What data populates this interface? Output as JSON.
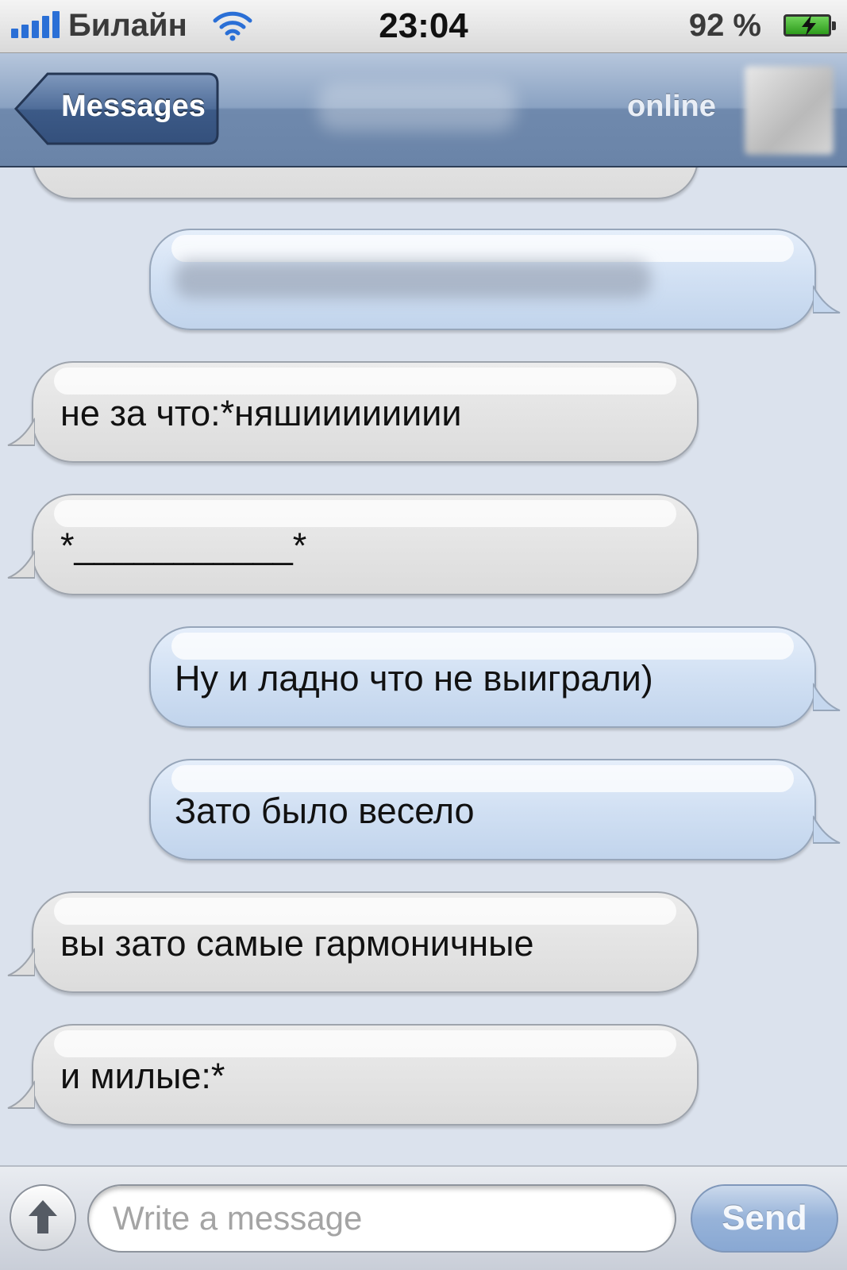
{
  "status_bar": {
    "carrier": "Билайн",
    "time": "23:04",
    "battery_percent": "92 %",
    "battery_level": 0.92,
    "signal_bars": 5,
    "icons": [
      "signal-icon",
      "wifi-icon",
      "battery-charging-icon"
    ]
  },
  "nav": {
    "back_label": "Messages",
    "status_label": "online",
    "icons": [
      "contact-photo"
    ]
  },
  "messages": [
    {
      "direction": "in",
      "text": ""
    },
    {
      "direction": "out",
      "text": ""
    },
    {
      "direction": "in",
      "text": "не за что:*няшииииииии"
    },
    {
      "direction": "in",
      "text": "*___________*"
    },
    {
      "direction": "out",
      "text": "Ну и ладно что не выиграли)"
    },
    {
      "direction": "out",
      "text": "Зато было весело"
    },
    {
      "direction": "in",
      "text": "вы зато самые гармоничные"
    },
    {
      "direction": "in",
      "text": "и милые:*"
    }
  ],
  "composer": {
    "placeholder": "Write a message",
    "send_label": "Send",
    "icons": [
      "camera-upload-icon"
    ]
  },
  "colors": {
    "background": "#dbe2ed",
    "nav_bar": "#6f89ad",
    "incoming_bubble": "#e4e4e4",
    "outgoing_bubble": "#d1e0f3",
    "signal": "#2a6fd6",
    "battery": "#2d9b1c"
  }
}
